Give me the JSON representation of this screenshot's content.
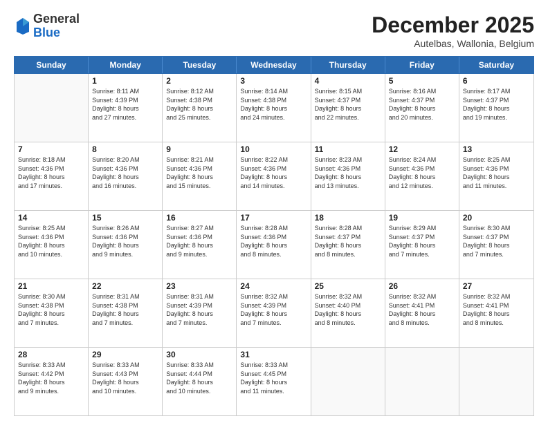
{
  "header": {
    "logo_general": "General",
    "logo_blue": "Blue",
    "month_title": "December 2025",
    "subtitle": "Autelbas, Wallonia, Belgium"
  },
  "days_of_week": [
    "Sunday",
    "Monday",
    "Tuesday",
    "Wednesday",
    "Thursday",
    "Friday",
    "Saturday"
  ],
  "weeks": [
    [
      {
        "day": "",
        "empty": true
      },
      {
        "day": "1",
        "sunrise": "Sunrise: 8:11 AM",
        "sunset": "Sunset: 4:39 PM",
        "daylight": "Daylight: 8 hours and 27 minutes."
      },
      {
        "day": "2",
        "sunrise": "Sunrise: 8:12 AM",
        "sunset": "Sunset: 4:38 PM",
        "daylight": "Daylight: 8 hours and 25 minutes."
      },
      {
        "day": "3",
        "sunrise": "Sunrise: 8:14 AM",
        "sunset": "Sunset: 4:38 PM",
        "daylight": "Daylight: 8 hours and 24 minutes."
      },
      {
        "day": "4",
        "sunrise": "Sunrise: 8:15 AM",
        "sunset": "Sunset: 4:37 PM",
        "daylight": "Daylight: 8 hours and 22 minutes."
      },
      {
        "day": "5",
        "sunrise": "Sunrise: 8:16 AM",
        "sunset": "Sunset: 4:37 PM",
        "daylight": "Daylight: 8 hours and 20 minutes."
      },
      {
        "day": "6",
        "sunrise": "Sunrise: 8:17 AM",
        "sunset": "Sunset: 4:37 PM",
        "daylight": "Daylight: 8 hours and 19 minutes."
      }
    ],
    [
      {
        "day": "7",
        "sunrise": "Sunrise: 8:18 AM",
        "sunset": "Sunset: 4:36 PM",
        "daylight": "Daylight: 8 hours and 17 minutes."
      },
      {
        "day": "8",
        "sunrise": "Sunrise: 8:20 AM",
        "sunset": "Sunset: 4:36 PM",
        "daylight": "Daylight: 8 hours and 16 minutes."
      },
      {
        "day": "9",
        "sunrise": "Sunrise: 8:21 AM",
        "sunset": "Sunset: 4:36 PM",
        "daylight": "Daylight: 8 hours and 15 minutes."
      },
      {
        "day": "10",
        "sunrise": "Sunrise: 8:22 AM",
        "sunset": "Sunset: 4:36 PM",
        "daylight": "Daylight: 8 hours and 14 minutes."
      },
      {
        "day": "11",
        "sunrise": "Sunrise: 8:23 AM",
        "sunset": "Sunset: 4:36 PM",
        "daylight": "Daylight: 8 hours and 13 minutes."
      },
      {
        "day": "12",
        "sunrise": "Sunrise: 8:24 AM",
        "sunset": "Sunset: 4:36 PM",
        "daylight": "Daylight: 8 hours and 12 minutes."
      },
      {
        "day": "13",
        "sunrise": "Sunrise: 8:25 AM",
        "sunset": "Sunset: 4:36 PM",
        "daylight": "Daylight: 8 hours and 11 minutes."
      }
    ],
    [
      {
        "day": "14",
        "sunrise": "Sunrise: 8:25 AM",
        "sunset": "Sunset: 4:36 PM",
        "daylight": "Daylight: 8 hours and 10 minutes."
      },
      {
        "day": "15",
        "sunrise": "Sunrise: 8:26 AM",
        "sunset": "Sunset: 4:36 PM",
        "daylight": "Daylight: 8 hours and 9 minutes."
      },
      {
        "day": "16",
        "sunrise": "Sunrise: 8:27 AM",
        "sunset": "Sunset: 4:36 PM",
        "daylight": "Daylight: 8 hours and 9 minutes."
      },
      {
        "day": "17",
        "sunrise": "Sunrise: 8:28 AM",
        "sunset": "Sunset: 4:36 PM",
        "daylight": "Daylight: 8 hours and 8 minutes."
      },
      {
        "day": "18",
        "sunrise": "Sunrise: 8:28 AM",
        "sunset": "Sunset: 4:37 PM",
        "daylight": "Daylight: 8 hours and 8 minutes."
      },
      {
        "day": "19",
        "sunrise": "Sunrise: 8:29 AM",
        "sunset": "Sunset: 4:37 PM",
        "daylight": "Daylight: 8 hours and 7 minutes."
      },
      {
        "day": "20",
        "sunrise": "Sunrise: 8:30 AM",
        "sunset": "Sunset: 4:37 PM",
        "daylight": "Daylight: 8 hours and 7 minutes."
      }
    ],
    [
      {
        "day": "21",
        "sunrise": "Sunrise: 8:30 AM",
        "sunset": "Sunset: 4:38 PM",
        "daylight": "Daylight: 8 hours and 7 minutes."
      },
      {
        "day": "22",
        "sunrise": "Sunrise: 8:31 AM",
        "sunset": "Sunset: 4:38 PM",
        "daylight": "Daylight: 8 hours and 7 minutes."
      },
      {
        "day": "23",
        "sunrise": "Sunrise: 8:31 AM",
        "sunset": "Sunset: 4:39 PM",
        "daylight": "Daylight: 8 hours and 7 minutes."
      },
      {
        "day": "24",
        "sunrise": "Sunrise: 8:32 AM",
        "sunset": "Sunset: 4:39 PM",
        "daylight": "Daylight: 8 hours and 7 minutes."
      },
      {
        "day": "25",
        "sunrise": "Sunrise: 8:32 AM",
        "sunset": "Sunset: 4:40 PM",
        "daylight": "Daylight: 8 hours and 8 minutes."
      },
      {
        "day": "26",
        "sunrise": "Sunrise: 8:32 AM",
        "sunset": "Sunset: 4:41 PM",
        "daylight": "Daylight: 8 hours and 8 minutes."
      },
      {
        "day": "27",
        "sunrise": "Sunrise: 8:32 AM",
        "sunset": "Sunset: 4:41 PM",
        "daylight": "Daylight: 8 hours and 8 minutes."
      }
    ],
    [
      {
        "day": "28",
        "sunrise": "Sunrise: 8:33 AM",
        "sunset": "Sunset: 4:42 PM",
        "daylight": "Daylight: 8 hours and 9 minutes."
      },
      {
        "day": "29",
        "sunrise": "Sunrise: 8:33 AM",
        "sunset": "Sunset: 4:43 PM",
        "daylight": "Daylight: 8 hours and 10 minutes."
      },
      {
        "day": "30",
        "sunrise": "Sunrise: 8:33 AM",
        "sunset": "Sunset: 4:44 PM",
        "daylight": "Daylight: 8 hours and 10 minutes."
      },
      {
        "day": "31",
        "sunrise": "Sunrise: 8:33 AM",
        "sunset": "Sunset: 4:45 PM",
        "daylight": "Daylight: 8 hours and 11 minutes."
      },
      {
        "day": "",
        "empty": true
      },
      {
        "day": "",
        "empty": true
      },
      {
        "day": "",
        "empty": true
      }
    ]
  ]
}
